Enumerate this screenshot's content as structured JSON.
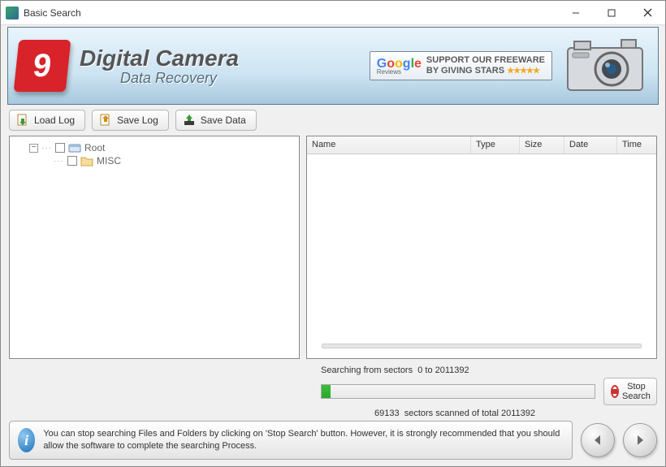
{
  "window": {
    "title": "Basic Search"
  },
  "header": {
    "title_line1": "Digital Camera",
    "title_line2": "Data Recovery",
    "review_support_line1": "SUPPORT OUR FREEWARE",
    "review_support_line2": "BY GIVING STARS",
    "reviews_label": "Reviews"
  },
  "toolbar": {
    "load_log": "Load Log",
    "save_log": "Save Log",
    "save_data": "Save Data"
  },
  "tree": {
    "root_label": "Root",
    "child1_label": "MISC"
  },
  "list": {
    "columns": {
      "name": "Name",
      "type": "Type",
      "size": "Size",
      "date": "Date",
      "time": "Time"
    }
  },
  "progress": {
    "label_prefix": "Searching from sectors",
    "range": "0 to 2011392",
    "scanned": "69133",
    "status_mid": "sectors scanned of total",
    "total": "2011392",
    "stop_label": "Stop Search"
  },
  "footer": {
    "info_text": "You can stop searching Files and Folders by clicking on 'Stop Search' button. However, it is strongly recommended that you should allow the software to complete the searching Process."
  }
}
